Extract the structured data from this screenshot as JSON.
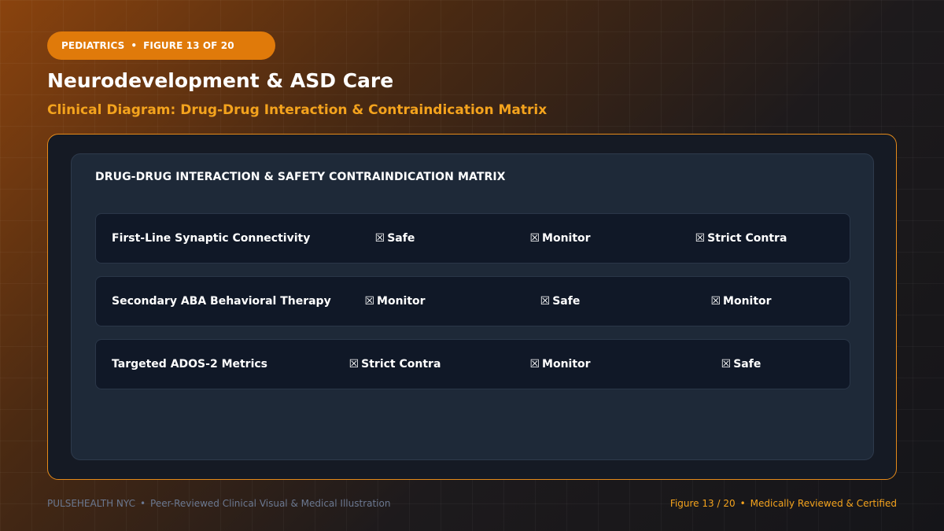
{
  "header": {
    "category": "PEDIATRICS",
    "separator": "•",
    "figure_label": "FIGURE 13 OF 20",
    "title": "Neurodevelopment & ASD Care",
    "subtitle": "Clinical Diagram: Drug-Drug Interaction & Contraindication Matrix"
  },
  "matrix": {
    "title": "DRUG-DRUG INTERACTION & SAFETY CONTRAINDICATION MATRIX",
    "rows": [
      {
        "label": "First-Line Synaptic Connectivity",
        "cells": [
          {
            "icon": "☒",
            "text": "Safe"
          },
          {
            "icon": "☒",
            "text": "Monitor"
          },
          {
            "icon": "☒",
            "text": "Strict Contra"
          }
        ]
      },
      {
        "label": "Secondary ABA Behavioral Therapy",
        "cells": [
          {
            "icon": "☒",
            "text": "Monitor"
          },
          {
            "icon": "☒",
            "text": "Safe"
          },
          {
            "icon": "☒",
            "text": "Monitor"
          }
        ]
      },
      {
        "label": "Targeted ADOS-2 Metrics",
        "cells": [
          {
            "icon": "☒",
            "text": "Strict Contra"
          },
          {
            "icon": "☒",
            "text": "Monitor"
          },
          {
            "icon": "☒",
            "text": "Safe"
          }
        ]
      }
    ]
  },
  "footer": {
    "brand": "PULSEHEALTH NYC",
    "separator": "•",
    "tagline": "Peer-Reviewed Clinical Visual & Medical Illustration",
    "figure": "Figure 13 / 20",
    "certification": "Medically Reviewed & Certified"
  },
  "colors": {
    "accent": "#e07a0a",
    "subtitle": "#f4a31d",
    "panel_border": "#e58a1a",
    "panel_bg": "#151a24",
    "inner_bg": "#1e2938",
    "row_bg": "#101827"
  }
}
